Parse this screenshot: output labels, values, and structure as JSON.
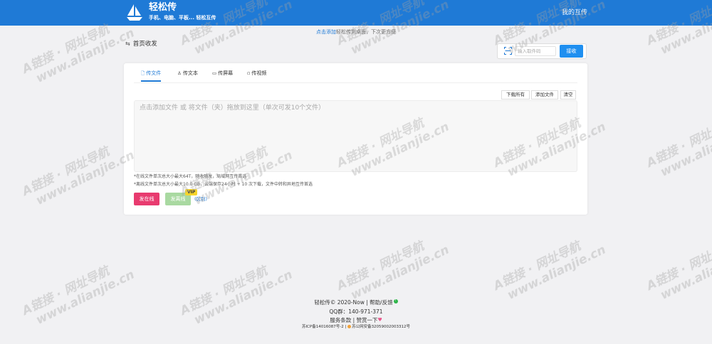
{
  "header": {
    "brand": "轻松传",
    "brand_sub": "手机、电脑、平板... 轻松互传",
    "nav_mine": "我的互传"
  },
  "notice": {
    "link": "点击添加",
    "text": "轻松传到桌面，下次更方便"
  },
  "section": {
    "icon": "⇆",
    "title": "首页收发"
  },
  "receive": {
    "code_placeholder": "输入取件码",
    "button": "接收"
  },
  "tabs": [
    {
      "icon": "🗋",
      "label": "传文件"
    },
    {
      "icon": "♙",
      "label": "传文本"
    },
    {
      "icon": "▭",
      "label": "传屏幕"
    },
    {
      "icon": "▫",
      "label": "传视频"
    }
  ],
  "toolbar": {
    "download_all": "下载所有",
    "add_file": "添加文件",
    "clear": "清空"
  },
  "dropzone": {
    "placeholder": "点击添加文件 或 将文件（夹）拖放到这里（单次可发10个文件）"
  },
  "notes": {
    "online": "*在线文件单次总大小最大64T，随收随发，局域网互传首选",
    "offline": "*离线文件单次总大小最大10.0 GB，云端保存24小时 + 10 次下载，文件中转和异地互传首选"
  },
  "actions": {
    "send_online": "发在线",
    "send_offline": "发离线",
    "vip": "VIP",
    "diff": "(区别)"
  },
  "footer": {
    "copyright": "轻松传© 2020-Now",
    "sep": " | ",
    "help": "帮助/反馈",
    "help_badge": "!",
    "qq": "QQ群：140-971-371",
    "terms": "服务条款",
    "reward": "赞赏一下",
    "heart": "♥",
    "icp": "苏ICP备14016087号-2",
    "police": "苏公网安备32059002003312号"
  },
  "watermark": {
    "line1": "A链接 · 网址导航",
    "line2": "www.alianjie.cn"
  },
  "colors": {
    "primary": "#1f7ad6",
    "send_online": "#e83b6f",
    "send_offline": "#a9d9a1",
    "vip": "#f6d52b"
  }
}
